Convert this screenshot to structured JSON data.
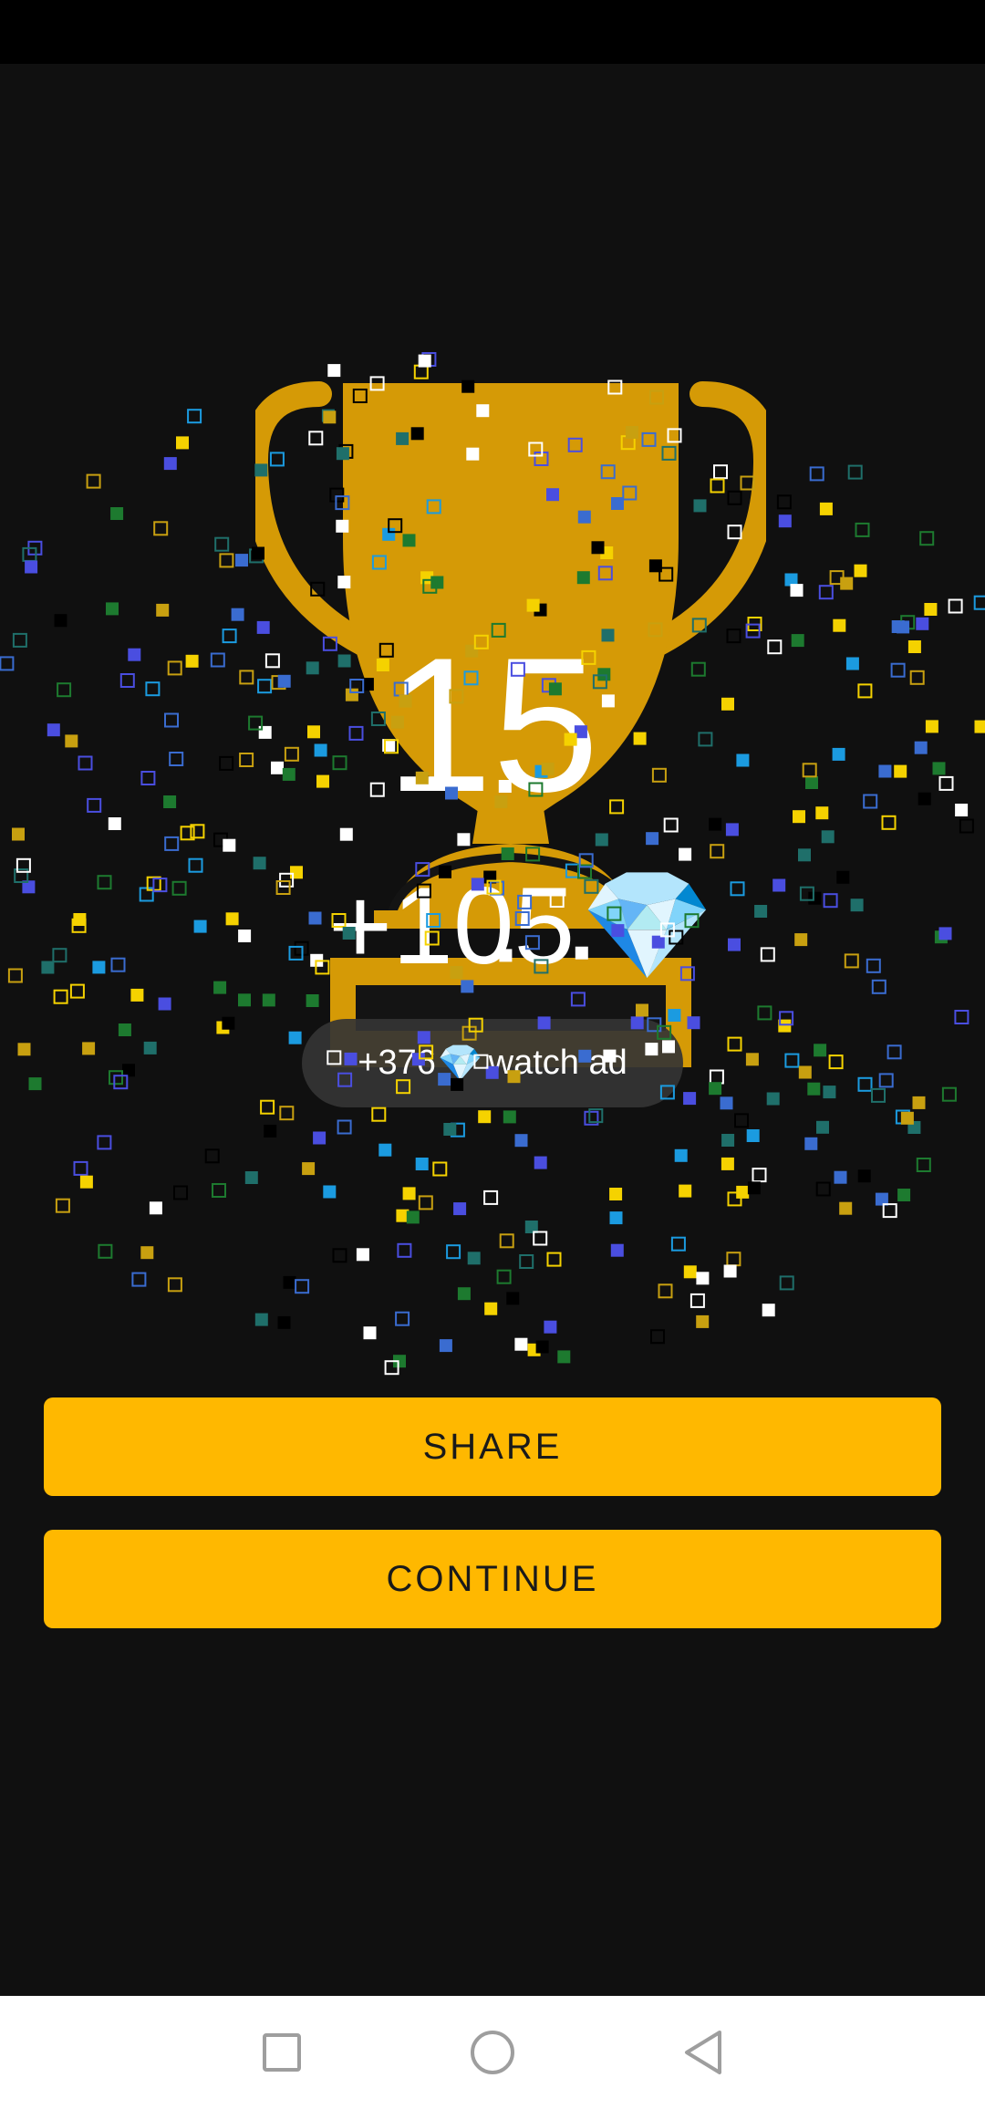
{
  "result": {
    "score": "15",
    "reward": "+105",
    "reward_icon": "gem-icon"
  },
  "watch_ad": {
    "bonus": "+376",
    "label": "watch ad"
  },
  "buttons": {
    "share": "SHARE",
    "continue": "CONTINUE"
  },
  "nav": {
    "recent": "square-icon",
    "home": "circle-icon",
    "back": "triangle-back-icon"
  },
  "colors": {
    "background": "#101010",
    "trophy": "#d59a06",
    "button": "#ffb800",
    "button_text": "#1a1a1a"
  }
}
